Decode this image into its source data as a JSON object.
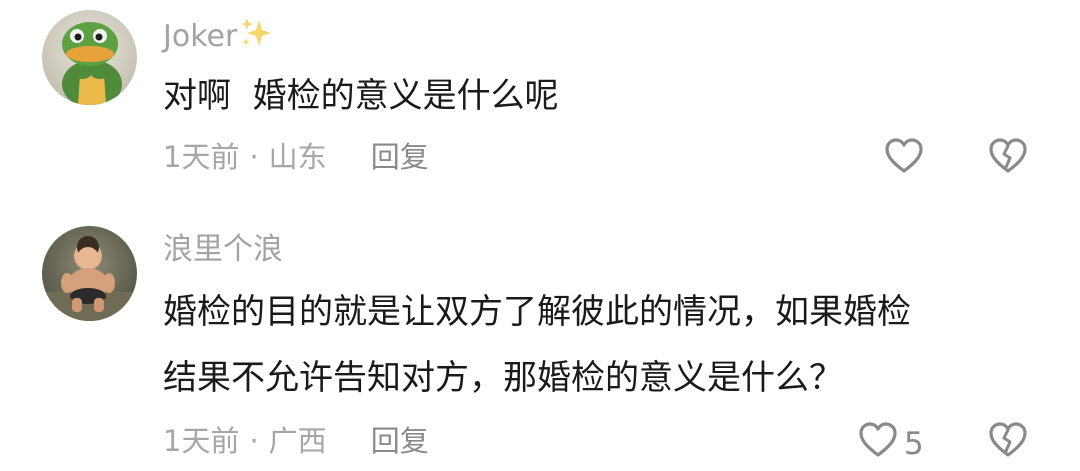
{
  "comments": [
    {
      "username": "Joker",
      "username_emoji": "sparkles-icon",
      "avatar": "green-duck-figurine-avatar",
      "content_lines": [
        "对啊  婚检的意义是什么呢"
      ],
      "time": "1天前",
      "separator": "·",
      "location": "山东",
      "reply_label": "回复",
      "like_count": "",
      "icons": {
        "like": "heart-outline-icon",
        "dislike": "broken-heart-icon"
      }
    },
    {
      "username": "浪里个浪",
      "avatar": "baby-photo-avatar",
      "content_lines": [
        "婚检的目的就是让双方了解彼此的情况，如果婚检",
        "结果不允许告知对方，那婚检的意义是什么？"
      ],
      "time": "1天前",
      "separator": "·",
      "location": "广西",
      "reply_label": "回复",
      "like_count": "5",
      "icons": {
        "like": "heart-outline-icon",
        "dislike": "broken-heart-icon"
      }
    }
  ],
  "colors": {
    "username": "#a3a3a3",
    "content": "#1a1a1a",
    "meta": "#a6a6a6",
    "icon_stroke": "#8a8a8a",
    "sparkle": "#f5d76e"
  }
}
